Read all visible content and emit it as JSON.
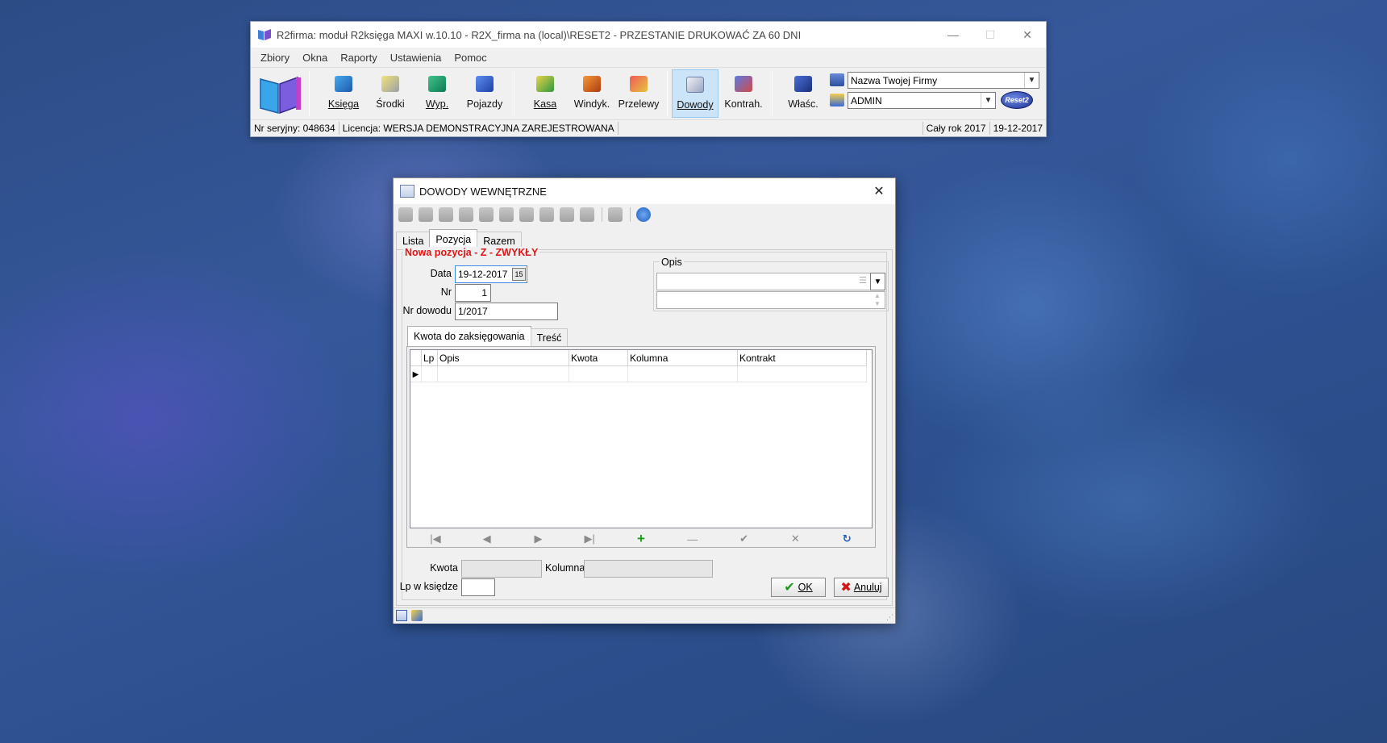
{
  "app": {
    "title": "R2firma: moduł R2księga MAXI w.10.10 - R2X_firma na (local)\\RESET2 - PRZESTANIE DRUKOWAĆ ZA 60 DNI",
    "minimize": "—",
    "maximize": "☐",
    "close": "✕",
    "menu": [
      "Zbiory",
      "Okna",
      "Raporty",
      "Ustawienia",
      "Pomoc"
    ],
    "toolbar": {
      "ksiega": "Księga",
      "srodki": "Środki",
      "wyp": "Wyp.",
      "pojazdy": "Pojazdy",
      "kasa": "Kasa",
      "windyk": "Windyk.",
      "przelewy": "Przelewy",
      "dowody": "Dowody",
      "kontrah": "Kontrah.",
      "wlasc": "Właśc."
    },
    "company_combo": "Nazwa Twojej Firmy",
    "user_combo": "ADMIN",
    "logo_text": "Reset2",
    "status": {
      "serial": "Nr seryjny: 048634",
      "license": "Licencja: WERSJA DEMONSTRACYJNA ZAREJESTROWANA",
      "year": "Cały rok 2017",
      "date": "19-12-2017"
    }
  },
  "dialog": {
    "title": "DOWODY WEWNĘTRZNE",
    "close": "✕",
    "tabs": [
      "Lista",
      "Pozycja",
      "Razem"
    ],
    "section_title": "Nowa pozycja - Z - ZWYKŁY",
    "labels": {
      "data": "Data",
      "nr": "Nr",
      "nr_dowodu": "Nr dowodu",
      "opis": "Opis",
      "kwota": "Kwota",
      "kolumna": "Kolumna",
      "lp_w_ksiedze": "Lp w księdze"
    },
    "values": {
      "data": "19-12-2017",
      "nr": "1",
      "nr_dowodu": "1/2017",
      "calendar_btn": "15"
    },
    "subtabs": [
      "Kwota do zaksięgowania",
      "Treść"
    ],
    "grid_columns": [
      "Lp",
      "Opis",
      "Kwota",
      "Kolumna",
      "Kontrakt"
    ],
    "nav": [
      "|◀",
      "◀",
      "▶",
      "▶|",
      "+",
      "—",
      "✔",
      "✕",
      "↻"
    ],
    "ok": "OK",
    "cancel": "Anuluj"
  }
}
